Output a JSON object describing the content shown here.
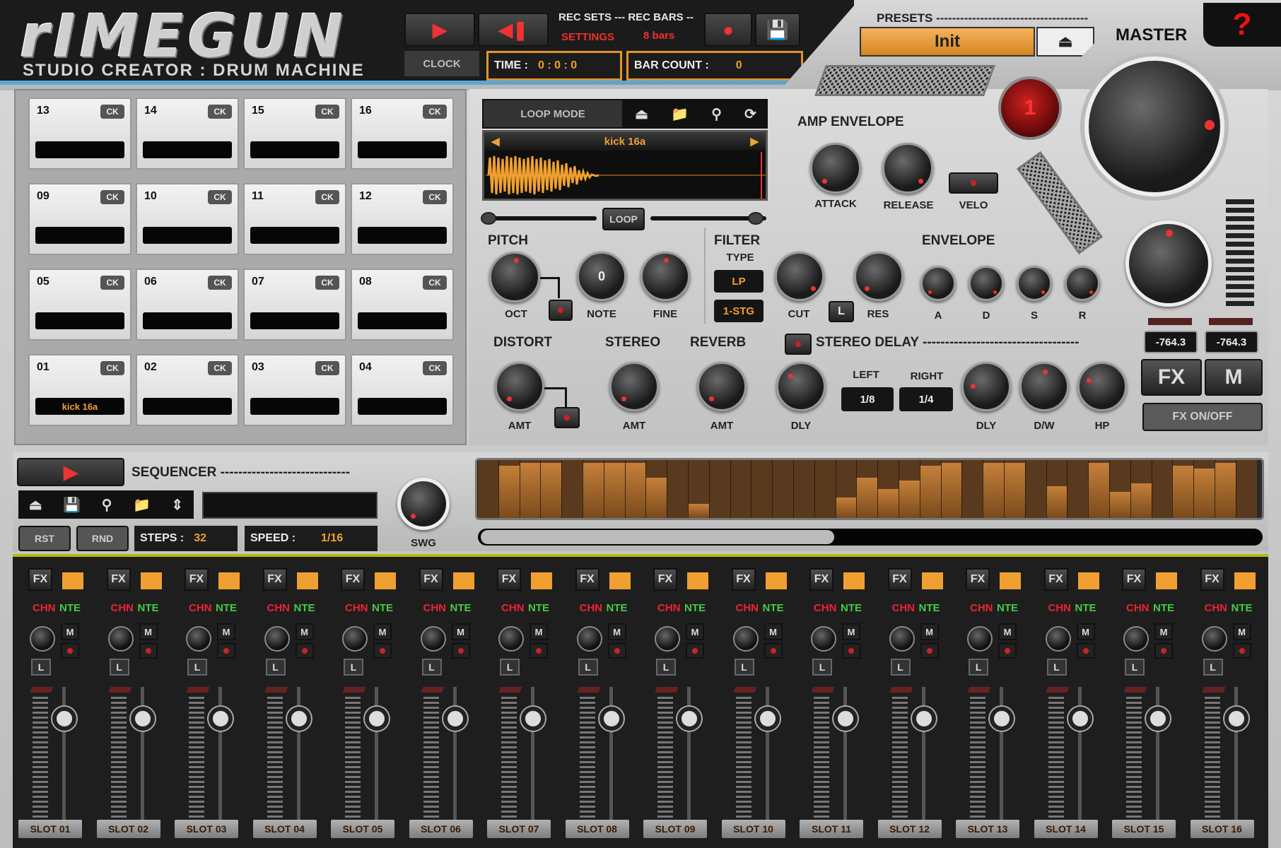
{
  "app": {
    "logo": "rIMEGUN",
    "subtitle": "STUDIO CREATOR : DRUM MACHINE"
  },
  "transport": {
    "rec_sets_label": "REC SETS --- REC BARS --",
    "settings_label": "SETTINGS",
    "bars_value": "8 bars",
    "clock_label": "CLOCK",
    "time_label": "TIME :",
    "time_value": "0 : 0 : 0",
    "bar_count_label": "BAR COUNT :",
    "bar_count_value": "0"
  },
  "presets": {
    "label": "PRESETS --------------------------------------",
    "current": "Init"
  },
  "master": {
    "label": "MASTER",
    "help": "?",
    "meter_left": "-764.3",
    "meter_right": "-764.3",
    "fx_label": "FX",
    "m_label": "M",
    "fx_onoff": "FX ON/OFF",
    "indicator": "1"
  },
  "pads": [
    {
      "num": "13",
      "ck": "CK",
      "sample": ""
    },
    {
      "num": "14",
      "ck": "CK",
      "sample": ""
    },
    {
      "num": "15",
      "ck": "CK",
      "sample": ""
    },
    {
      "num": "16",
      "ck": "CK",
      "sample": ""
    },
    {
      "num": "09",
      "ck": "CK",
      "sample": ""
    },
    {
      "num": "10",
      "ck": "CK",
      "sample": ""
    },
    {
      "num": "11",
      "ck": "CK",
      "sample": ""
    },
    {
      "num": "12",
      "ck": "CK",
      "sample": ""
    },
    {
      "num": "05",
      "ck": "CK",
      "sample": ""
    },
    {
      "num": "06",
      "ck": "CK",
      "sample": ""
    },
    {
      "num": "07",
      "ck": "CK",
      "sample": ""
    },
    {
      "num": "08",
      "ck": "CK",
      "sample": ""
    },
    {
      "num": "01",
      "ck": "CK",
      "sample": "kick 16a"
    },
    {
      "num": "02",
      "ck": "CK",
      "sample": ""
    },
    {
      "num": "03",
      "ck": "CK",
      "sample": ""
    },
    {
      "num": "04",
      "ck": "CK",
      "sample": ""
    }
  ],
  "sample": {
    "loop_mode": "LOOP MODE",
    "name": "kick 16a",
    "loop": "LOOP"
  },
  "amp_env": {
    "title": "AMP ENVELOPE",
    "attack": "ATTACK",
    "release": "RELEASE",
    "velo": "VELO"
  },
  "pitch": {
    "title": "PITCH",
    "oct": "OCT",
    "note": "NOTE",
    "note_value": "0",
    "fine": "FINE"
  },
  "filter": {
    "title": "FILTER",
    "type_label": "TYPE",
    "type_value": "LP",
    "stage_value": "1-STG",
    "cut": "CUT",
    "res": "RES",
    "l_btn": "L"
  },
  "envelope": {
    "title": "ENVELOPE",
    "a": "A",
    "d": "D",
    "s": "S",
    "r": "R"
  },
  "fx": {
    "distort": "DISTORT",
    "stereo": "STEREO",
    "reverb": "REVERB",
    "stereo_delay": "STEREO DELAY -----------------------------------",
    "amt": "AMT",
    "dly": "DLY",
    "dw": "D/W",
    "hp": "HP",
    "left_label": "LEFT",
    "right_label": "RIGHT",
    "left_value": "1/8",
    "right_value": "1/4"
  },
  "sequencer": {
    "title": "SEQUENCER -----------------------------",
    "rst": "RST",
    "rnd": "RND",
    "steps_label": "STEPS :",
    "steps_value": "32",
    "speed_label": "SPEED :",
    "speed_value": "1/16",
    "swg": "SWG",
    "step_levels": [
      0.0,
      0.9,
      0.95,
      0.95,
      0.0,
      0.95,
      0.95,
      0.95,
      0.7,
      0.0,
      0.25,
      0.0,
      0.0,
      0.0,
      0.0,
      0.0,
      0.0,
      0.35,
      0.7,
      0.5,
      0.65,
      0.9,
      0.95,
      0.0,
      0.95,
      0.95,
      0.0,
      0.55,
      0.0,
      0.95,
      0.45,
      0.6,
      0.0,
      0.9,
      0.85,
      0.95,
      0.0
    ]
  },
  "mixer": {
    "fx": "FX",
    "chn": "CHN",
    "nte": "NTE",
    "m": "M",
    "l": "L",
    "slots": [
      "SLOT 01",
      "SLOT 02",
      "SLOT 03",
      "SLOT 04",
      "SLOT 05",
      "SLOT 06",
      "SLOT 07",
      "SLOT 08",
      "SLOT 09",
      "SLOT 10",
      "SLOT 11",
      "SLOT 12",
      "SLOT 13",
      "SLOT 14",
      "SLOT 15",
      "SLOT 16"
    ]
  }
}
